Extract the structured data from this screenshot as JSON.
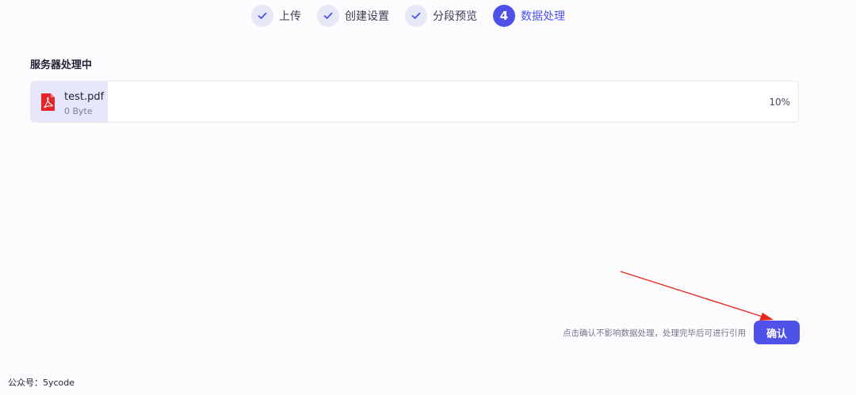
{
  "stepper": {
    "steps": [
      {
        "label": "上传",
        "status": "done"
      },
      {
        "label": "创建设置",
        "status": "done"
      },
      {
        "label": "分段预览",
        "status": "done"
      },
      {
        "label": "数据处理",
        "status": "active",
        "number": "4"
      }
    ]
  },
  "processing": {
    "title": "服务器处理中",
    "file": {
      "name": "test.pdf",
      "size": "0 Byte",
      "percent_text": "10%",
      "progress": 0.1,
      "icon": "pdf-file-icon"
    }
  },
  "footer": {
    "hint": "点击确认不影响数据处理，处理完毕后可进行引用",
    "confirm_label": "确认"
  },
  "watermark": "公众号：5ycode",
  "colors": {
    "accent": "#4e52e8",
    "step_done_bg": "#e6e8f6",
    "progress_fill": "#e6e7fb",
    "pdf_red": "#e5252a",
    "annotation_arrow": "#e8261b"
  }
}
